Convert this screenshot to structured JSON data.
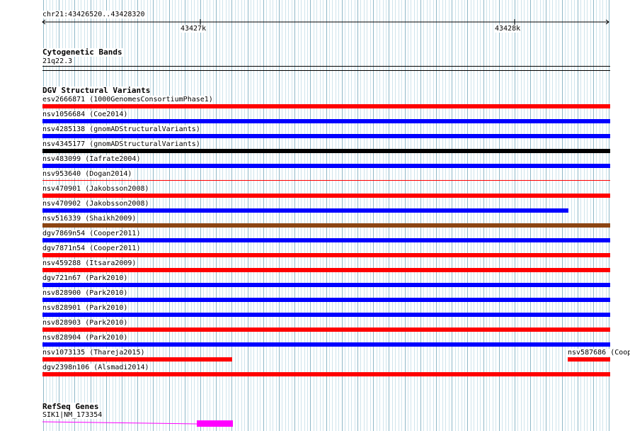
{
  "ruler": {
    "location": "chr21:43426520..43428320",
    "ticks": [
      "43427k",
      "43428k"
    ]
  },
  "cytoband": {
    "title": "Cytogenetic Bands",
    "band": "21q22.3"
  },
  "dgv": {
    "title": "DGV Structural Variants",
    "features": [
      {
        "label": "esv2666871 (1000GenomesConsortiumPhase1)",
        "color": "#ff0000"
      },
      {
        "label": "nsv1056684 (Coe2014)",
        "color": "#0000ff"
      },
      {
        "label": "nsv4285138 (gnomADStructuralVariants)",
        "color": "#0000ff"
      },
      {
        "label": "nsv4345177 (gnomADStructuralVariants)",
        "color": "#000000"
      },
      {
        "label": "nsv483099 (Iafrate2004)",
        "color": "#0000ff"
      },
      {
        "label": "nsv953640 (Dogan2014)",
        "color": "#ff0000"
      },
      {
        "label": "nsv470901 (Jakobsson2008)",
        "color": "#ff0000"
      },
      {
        "label": "nsv470902 (Jakobsson2008)",
        "color": "#0000ff"
      },
      {
        "label": "nsv516339 (Shaikh2009)",
        "color": "#8b4513"
      },
      {
        "label": "dgv7869n54 (Cooper2011)",
        "color": "#0000ff"
      },
      {
        "label": "dgv7871n54 (Cooper2011)",
        "color": "#ff0000"
      },
      {
        "label": "nsv459288 (Itsara2009)",
        "color": "#ff0000"
      },
      {
        "label": "dgv721n67 (Park2010)",
        "color": "#0000ff"
      },
      {
        "label": "nsv828900 (Park2010)",
        "color": "#0000ff"
      },
      {
        "label": "nsv828901 (Park2010)",
        "color": "#0000ff"
      },
      {
        "label": "nsv828903 (Park2010)",
        "color": "#ff0000"
      },
      {
        "label": "nsv828904 (Park2010)",
        "color": "#0000ff"
      },
      {
        "label": "nsv1073135 (Thareja2015)",
        "color": "#ff0000"
      },
      {
        "label": "nsv587686 (Coop",
        "color": "#ff0000"
      },
      {
        "label": "dgv2398n106 (Alsmadi2014)",
        "color": "#ff0000"
      }
    ]
  },
  "refseq": {
    "title": "RefSeq Genes",
    "gene_label": "SIK1|NM_173354",
    "color": "#ff00ff"
  },
  "colors": {
    "grid_major": "#8fb8c8",
    "grid_minor": "#cfe4ec",
    "feature_red": "#ff0000",
    "feature_blue": "#0000ff",
    "feature_black": "#000000",
    "feature_brown": "#8b4513",
    "gene_magenta": "#ff00ff"
  }
}
